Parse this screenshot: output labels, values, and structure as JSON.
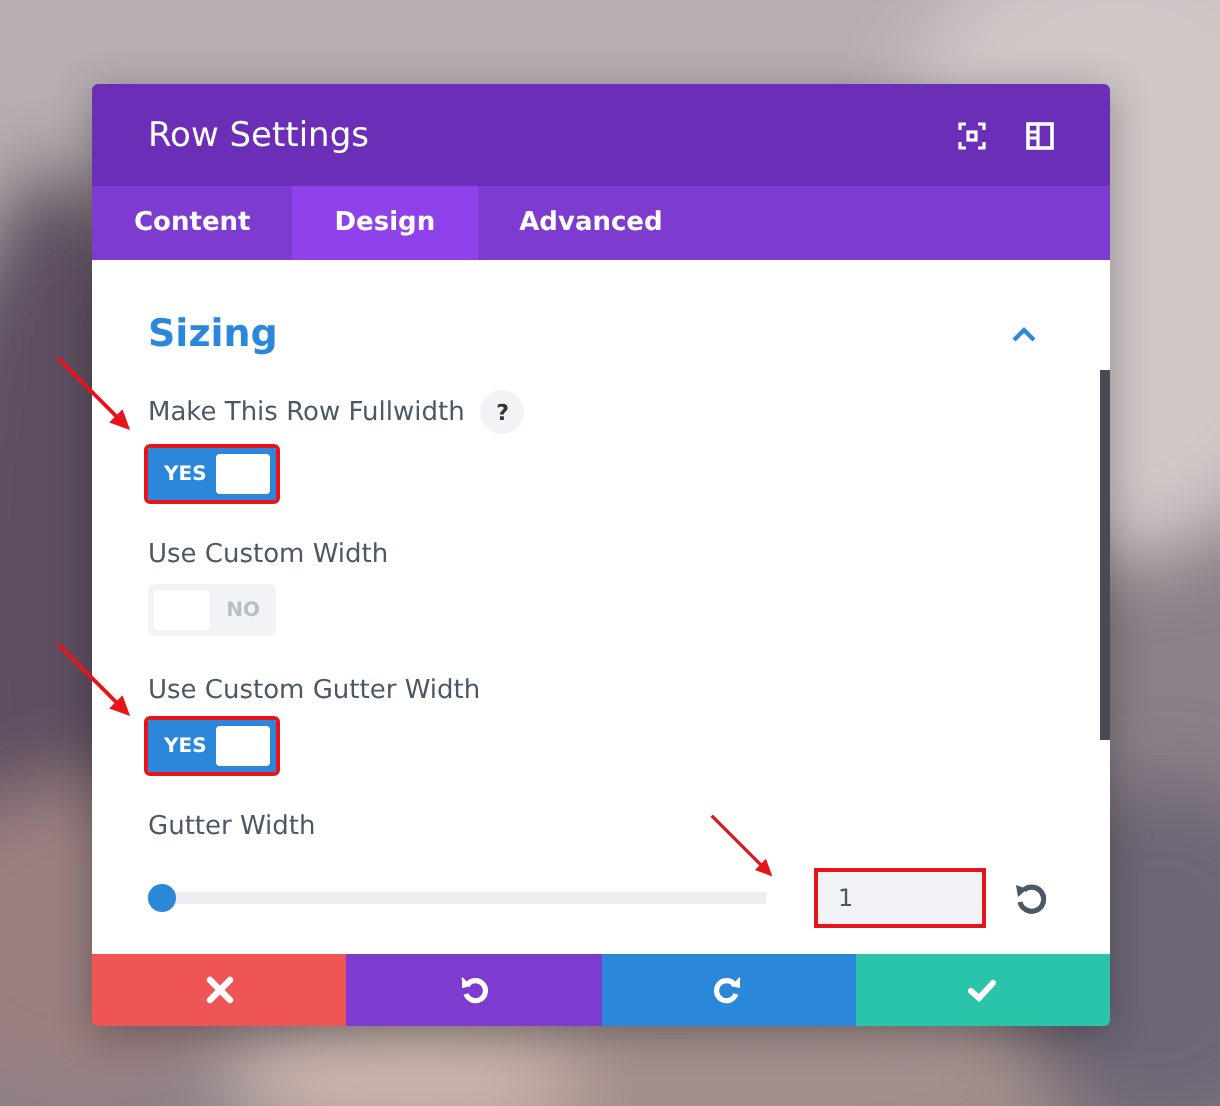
{
  "window": {
    "title": "Row Settings"
  },
  "tabs": [
    {
      "label": "Content",
      "selected": false
    },
    {
      "label": "Design",
      "selected": true
    },
    {
      "label": "Advanced",
      "selected": false
    }
  ],
  "section": {
    "title": "Sizing",
    "expanded": true
  },
  "fields": [
    {
      "kind": "toggle",
      "label": "Make This Row Fullwidth",
      "help": "?",
      "on": true,
      "state_text": "YES",
      "highlighted": true
    },
    {
      "kind": "toggle",
      "label": "Use Custom Width",
      "on": false,
      "state_text": "NO",
      "highlighted": false
    },
    {
      "kind": "toggle",
      "label": "Use Custom Gutter Width",
      "on": true,
      "state_text": "YES",
      "highlighted": true
    },
    {
      "kind": "slider",
      "label": "Gutter Width",
      "level": 0,
      "value": "1",
      "highlighted": true
    }
  ],
  "footer": [
    {
      "kind": "cancel"
    },
    {
      "kind": "undo"
    },
    {
      "kind": "redo"
    },
    {
      "kind": "save"
    }
  ]
}
